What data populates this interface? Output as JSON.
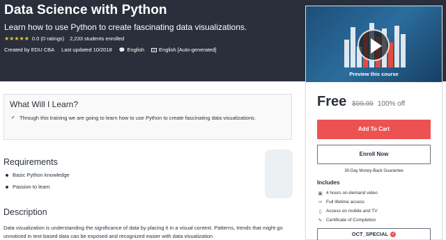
{
  "hero": {
    "title": "Data Science with Python",
    "subtitle": "Learn how to use Python to create fascinating data visualizations.",
    "stars": "★★★★★",
    "rating": "0.0 (0 ratings)",
    "students": "2,233 students enrolled",
    "created_by": "Created by EDU CBA",
    "updated": "Last updated 10/2018",
    "language": "English",
    "captions": "English [Auto-generated]"
  },
  "sidebar": {
    "preview_label": "Preview this course",
    "price": "Free",
    "old_price": "$99.99",
    "discount": "100% off",
    "add_to_cart": "Add To Cart",
    "enroll": "Enroll Now",
    "guarantee": "30-Day Money-Back Guarantee",
    "includes_title": "Includes",
    "includes": [
      {
        "icon": "video-icon",
        "label": "4 hours on-demand video"
      },
      {
        "icon": "infinity-icon",
        "label": "Full lifetime access"
      },
      {
        "icon": "mobile-icon",
        "label": "Access on mobile and TV"
      },
      {
        "icon": "certificate-icon",
        "label": "Certificate of Completion"
      }
    ],
    "coupon": "OCT_SPECIAL"
  },
  "learn": {
    "title": "What Will I Learn?",
    "items": [
      "Through this training we are going to learn how to use Python to create fascinating data visualizations."
    ]
  },
  "requirements": {
    "title": "Requirements",
    "items": [
      "Basic Python knowledge",
      "Passion to learn"
    ]
  },
  "description": {
    "title": "Description",
    "text": "Data visualization is understanding the significance of data by placing it in a visual context. Patterns, trends that might go unnoticed in text-based data can be exposed and recognized easier with data visualization"
  },
  "colors": {
    "header_bg": "#29303b",
    "accent_red": "#ec5252",
    "star": "#f4c150"
  }
}
